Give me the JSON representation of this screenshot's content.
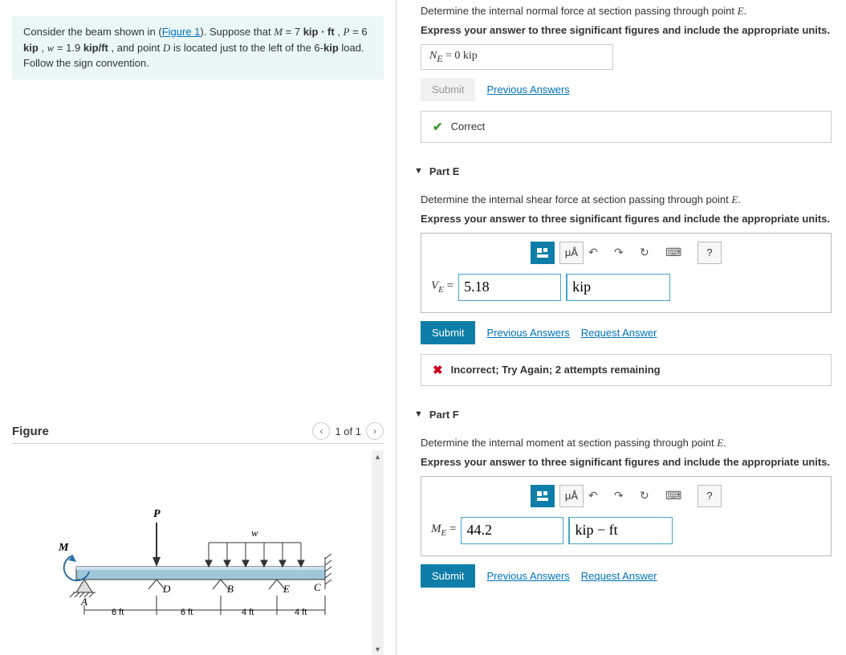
{
  "problem": {
    "prefix": "Consider the beam shown in (",
    "figure_link": "Figure 1",
    "after_link": "). Suppose that ",
    "m_symbol": "M",
    "m_eq": " = 7 kip · ft",
    "p_symbol": "P",
    "p_eq": " = 6 kip",
    "w_symbol": "w",
    "w_eq": " = 1.9 kip/ft",
    "d_symbol": "D",
    "rest": " is located just to the left of the 6-",
    "bold_kip": "kip",
    "rest2": " load. Follow the sign convention."
  },
  "figure": {
    "title": "Figure",
    "counter": "1 of 1",
    "labels": {
      "P": "P",
      "M": "M",
      "w": "w",
      "A": "A",
      "B": "B",
      "C": "C",
      "D": "D",
      "E": "E"
    },
    "dims": [
      "6 ft",
      "6 ft",
      "4 ft",
      "4 ft"
    ]
  },
  "partD": {
    "prompt": "Determine the internal normal force at section passing through point ",
    "point": "E",
    "suffix": ".",
    "instruction": "Express your answer to three significant figures and include the appropriate units.",
    "eq_prefix": "N",
    "eq_sub": "E",
    "eq_rest": " =  0 kip",
    "submit": "Submit",
    "prev": "Previous Answers",
    "feedback": "Correct"
  },
  "partE": {
    "title": "Part E",
    "prompt": "Determine the internal shear force at section passing through point ",
    "point": "E",
    "suffix": ".",
    "instruction": "Express your answer to three significant figures and include the appropriate units.",
    "label_pre": "V",
    "label_sub": "E",
    "label_eq": " = ",
    "value": "5.18",
    "unit": "kip",
    "submit": "Submit",
    "prev": "Previous Answers",
    "request": "Request Answer",
    "feedback": "Incorrect; Try Again; 2 attempts remaining",
    "toolbar": {
      "units_label": "μÅ",
      "help": "?"
    }
  },
  "partF": {
    "title": "Part F",
    "prompt": "Determine the internal moment at section passing through point ",
    "point": "E",
    "suffix": ".",
    "instruction": "Express your answer to three significant figures and include the appropriate units.",
    "label_pre": "M",
    "label_sub": "E",
    "label_eq": " = ",
    "value": "44.2",
    "unit": "kip − ft",
    "submit": "Submit",
    "prev": "Previous Answers",
    "request": "Request Answer",
    "toolbar": {
      "units_label": "μÅ",
      "help": "?"
    }
  },
  "icons": {
    "prev": "‹",
    "next": "›",
    "up": "▲",
    "down": "▼",
    "caret": "▼",
    "check": "✔",
    "cross": "✖",
    "undo": "↶",
    "redo": "↷",
    "reset": "↻",
    "keyboard": "⌨"
  }
}
